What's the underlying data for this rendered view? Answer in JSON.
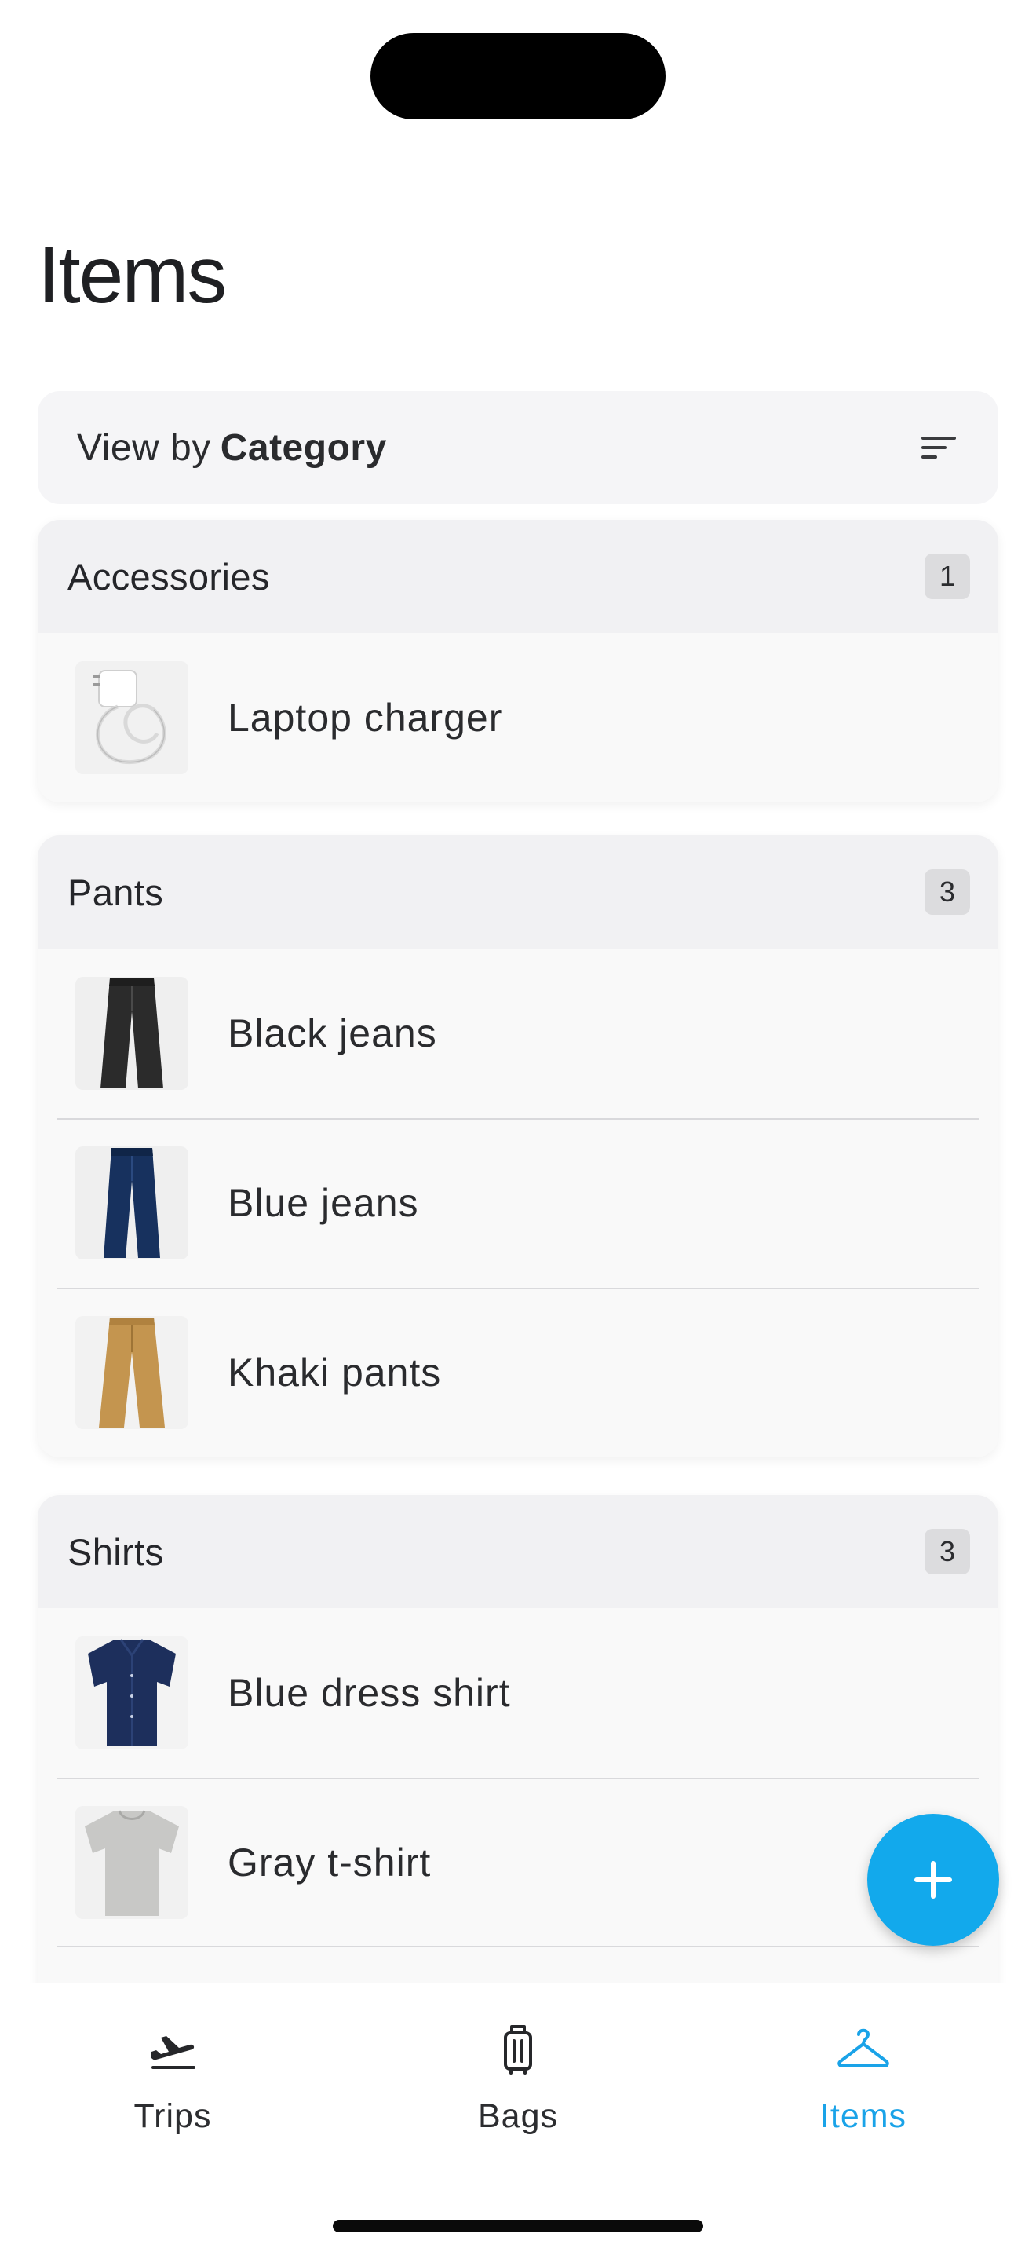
{
  "page": {
    "title": "Items"
  },
  "view_bar": {
    "prefix": "View by",
    "value": "Category",
    "icon": "sort-icon"
  },
  "categories": [
    {
      "name": "Accessories",
      "count": "1",
      "items": [
        {
          "label": "Laptop charger",
          "icon": "laptop-charger-thumbnail"
        }
      ]
    },
    {
      "name": "Pants",
      "count": "3",
      "items": [
        {
          "label": "Black jeans",
          "icon": "black-jeans-thumbnail"
        },
        {
          "label": "Blue jeans",
          "icon": "blue-jeans-thumbnail"
        },
        {
          "label": "Khaki pants",
          "icon": "khaki-pants-thumbnail"
        }
      ]
    },
    {
      "name": "Shirts",
      "count": "3",
      "items": [
        {
          "label": "Blue dress shirt",
          "icon": "blue-dress-shirt-thumbnail"
        },
        {
          "label": "Gray t-shirt",
          "icon": "gray-tshirt-thumbnail"
        }
      ]
    }
  ],
  "fab": {
    "icon": "plus-icon"
  },
  "nav": {
    "items": [
      {
        "label": "Trips",
        "icon": "airplane-departure-icon",
        "active": false
      },
      {
        "label": "Bags",
        "icon": "luggage-icon",
        "active": false
      },
      {
        "label": "Items",
        "icon": "hanger-icon",
        "active": true
      }
    ]
  },
  "colors": {
    "accent": "#12a9ec",
    "active_nav": "#1aa3e8",
    "card_bg": "#f9f9f9",
    "header_bg": "#f1f1f3"
  }
}
